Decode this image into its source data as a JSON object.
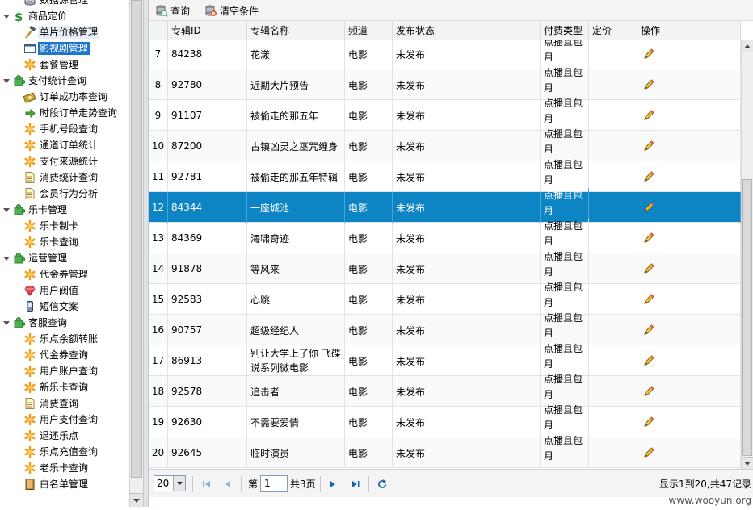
{
  "sidebar": {
    "items": [
      {
        "label": "数据源管理",
        "level": 2,
        "icon": "db-icon"
      },
      {
        "label": "商品定价",
        "level": 1,
        "icon": "dollar-icon",
        "expander": "minus"
      },
      {
        "label": "单片价格管理",
        "level": 2,
        "icon": "hammer-icon",
        "state": "hover"
      },
      {
        "label": "影视剧管理",
        "level": 2,
        "icon": "window-icon",
        "state": "selected"
      },
      {
        "label": "套餐管理",
        "level": 2,
        "icon": "star-icon"
      },
      {
        "label": "支付统计查询",
        "level": 1,
        "icon": "puzzle-icon",
        "expander": "minus"
      },
      {
        "label": "订单成功率查询",
        "level": 2,
        "icon": "money-icon"
      },
      {
        "label": "时段订单走势查询",
        "level": 2,
        "icon": "arrow-icon"
      },
      {
        "label": "手机号段查询",
        "level": 2,
        "icon": "star-icon"
      },
      {
        "label": "通道订单统计",
        "level": 2,
        "icon": "star-icon"
      },
      {
        "label": "支付来源统计",
        "level": 2,
        "icon": "star-icon"
      },
      {
        "label": "消费统计查询",
        "level": 2,
        "icon": "doc-icon"
      },
      {
        "label": "会员行为分析",
        "level": 2,
        "icon": "doc-icon"
      },
      {
        "label": "乐卡管理",
        "level": 1,
        "icon": "puzzle-icon",
        "expander": "minus"
      },
      {
        "label": "乐卡制卡",
        "level": 2,
        "icon": "star-icon"
      },
      {
        "label": "乐卡查询",
        "level": 2,
        "icon": "star-icon"
      },
      {
        "label": "运营管理",
        "level": 1,
        "icon": "puzzle-icon",
        "expander": "minus"
      },
      {
        "label": "代金券管理",
        "level": 2,
        "icon": "star-icon"
      },
      {
        "label": "用户阀值",
        "level": 2,
        "icon": "gem-icon"
      },
      {
        "label": "短信文案",
        "level": 2,
        "icon": "phone-icon"
      },
      {
        "label": "客服查询",
        "level": 1,
        "icon": "puzzle-icon",
        "expander": "minus"
      },
      {
        "label": "乐点余额转账",
        "level": 2,
        "icon": "star-icon"
      },
      {
        "label": "代金券查询",
        "level": 2,
        "icon": "star-icon"
      },
      {
        "label": "用户账户查询",
        "level": 2,
        "icon": "star-icon"
      },
      {
        "label": "新乐卡查询",
        "level": 2,
        "icon": "star-icon"
      },
      {
        "label": "消费查询",
        "level": 2,
        "icon": "doc-icon"
      },
      {
        "label": "用户支付查询",
        "level": 2,
        "icon": "star-icon"
      },
      {
        "label": "退还乐点",
        "level": 2,
        "icon": "star-icon"
      },
      {
        "label": "乐点充值查询",
        "level": 2,
        "icon": "star-icon"
      },
      {
        "label": "老乐卡查询",
        "level": 2,
        "icon": "star-icon"
      },
      {
        "label": "白名单管理",
        "level": 2,
        "icon": "book-icon"
      }
    ]
  },
  "toolbar": {
    "query_label": "查询",
    "clear_label": "清空条件"
  },
  "grid": {
    "headers": {
      "id": "专辑ID",
      "name": "专辑名称",
      "channel": "频道",
      "status": "发布状态",
      "paytype": "付费类型",
      "price": "定价",
      "action": "操作"
    },
    "rows": [
      {
        "n": "7",
        "id": "84238",
        "name": "花漾",
        "channel": "电影",
        "status": "未发布",
        "paytype": "点播且包月",
        "price": ""
      },
      {
        "n": "8",
        "id": "92780",
        "name": "近期大片预告",
        "channel": "电影",
        "status": "未发布",
        "paytype": "点播且包月",
        "price": ""
      },
      {
        "n": "9",
        "id": "91107",
        "name": "被偷走的那五年",
        "channel": "电影",
        "status": "未发布",
        "paytype": "点播且包月",
        "price": ""
      },
      {
        "n": "10",
        "id": "87200",
        "name": "古镇凶灵之巫咒缠身",
        "channel": "电影",
        "status": "未发布",
        "paytype": "点播且包月",
        "price": ""
      },
      {
        "n": "11",
        "id": "92781",
        "name": "被偷走的那五年特辑",
        "channel": "电影",
        "status": "未发布",
        "paytype": "点播且包月",
        "price": ""
      },
      {
        "n": "12",
        "id": "84344",
        "name": "一座城池",
        "channel": "电影",
        "status": "未发布",
        "paytype": "点播且包月",
        "price": "",
        "selected": true
      },
      {
        "n": "13",
        "id": "84369",
        "name": "海啸奇迹",
        "channel": "电影",
        "status": "未发布",
        "paytype": "点播且包月",
        "price": ""
      },
      {
        "n": "14",
        "id": "91878",
        "name": "等风来",
        "channel": "电影",
        "status": "未发布",
        "paytype": "点播且包月",
        "price": ""
      },
      {
        "n": "15",
        "id": "92583",
        "name": "心跳",
        "channel": "电影",
        "status": "未发布",
        "paytype": "点播且包月",
        "price": ""
      },
      {
        "n": "16",
        "id": "90757",
        "name": "超级经纪人",
        "channel": "电影",
        "status": "未发布",
        "paytype": "点播且包月",
        "price": ""
      },
      {
        "n": "17",
        "id": "86913",
        "name": "别让大学上了你 飞碟说系列微电影",
        "channel": "电影",
        "status": "未发布",
        "paytype": "点播且包月",
        "price": ""
      },
      {
        "n": "18",
        "id": "92578",
        "name": "追击者",
        "channel": "电影",
        "status": "未发布",
        "paytype": "点播且包月",
        "price": ""
      },
      {
        "n": "19",
        "id": "92630",
        "name": "不需要爱情",
        "channel": "电影",
        "status": "未发布",
        "paytype": "点播且包月",
        "price": ""
      },
      {
        "n": "20",
        "id": "92645",
        "name": "临时演员",
        "channel": "电影",
        "status": "未发布",
        "paytype": "点播且包月",
        "price": ""
      }
    ]
  },
  "pager": {
    "page_size": "20",
    "page_prefix": "第",
    "page_value": "1",
    "page_suffix": "共3页",
    "info": "显示1到20,共47记录"
  },
  "watermark": "www.wooyun.org",
  "colors": {
    "selected_row": "#0d84c4",
    "selected_tree": "#1e76c8"
  }
}
